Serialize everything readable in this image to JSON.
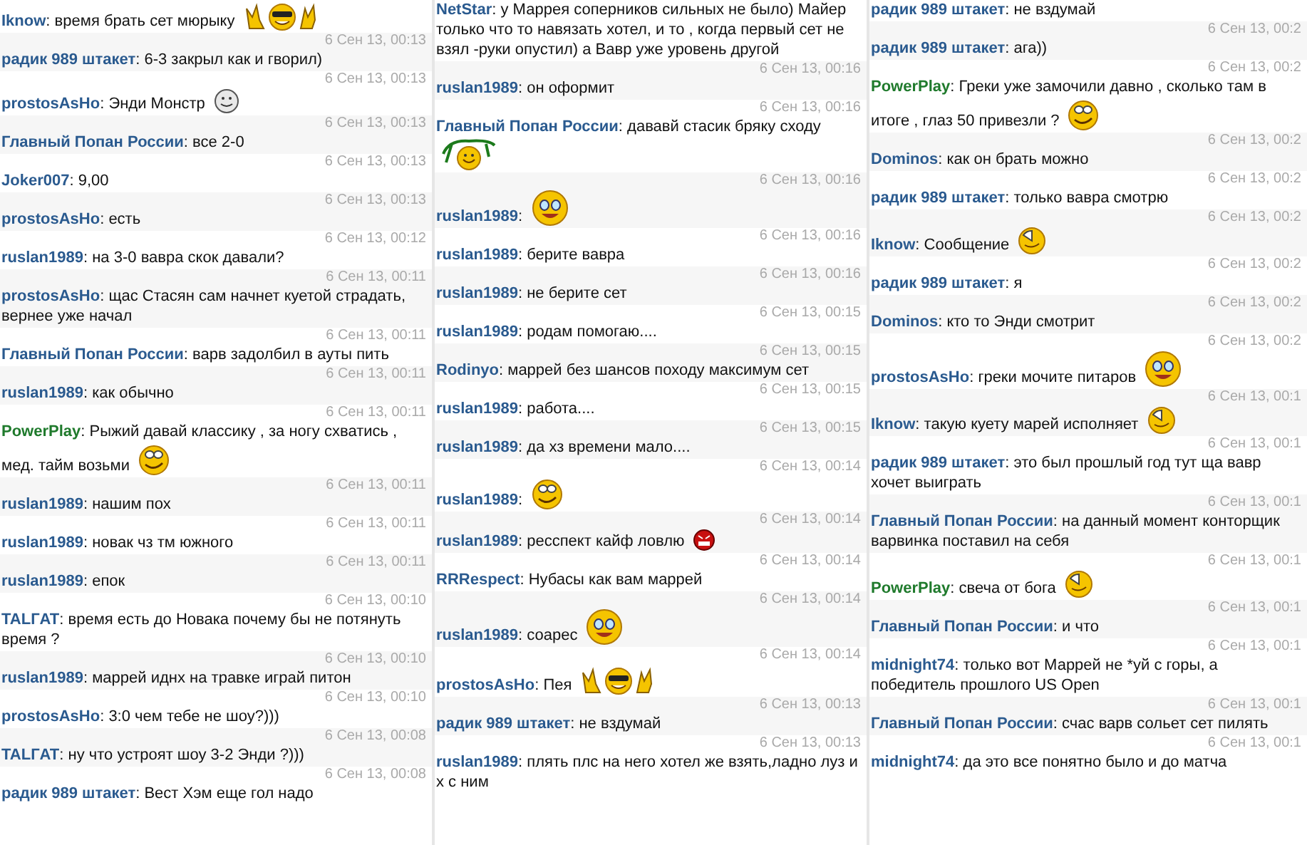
{
  "columns": [
    {
      "messages": [
        {
          "author": "Iknow",
          "separator": ":",
          "color": "#2a5a8f",
          "text": "время брать сет мюрыку",
          "emoticon": {
            "kind": "victory"
          }
        },
        {
          "time": "6 Сен 13, 00:13",
          "author": "радик 989 штакет",
          "separator": ":",
          "color": "#2a5a8f",
          "text": "6-3 закрыл как и гворил)"
        },
        {
          "time": "6 Сен 13, 00:13",
          "author": "prostosAsHo",
          "separator": ":",
          "color": "#2a5a8f",
          "text": "Энди Монстр",
          "emoticon": {
            "kind": "smile"
          }
        },
        {
          "time": "6 Сен 13, 00:13",
          "author": "Главный Попан России",
          "separator": ":",
          "color": "#2a5a8f",
          "text": "все 2-0"
        },
        {
          "time": "6 Сен 13, 00:13",
          "author": "Joker007",
          "separator": ":",
          "color": "#2a5a8f",
          "text": "9,00"
        },
        {
          "time": "6 Сен 13, 00:13",
          "author": "prostosAsHo",
          "separator": ":",
          "color": "#2a5a8f",
          "text": "есть"
        },
        {
          "time": "6 Сен 13, 00:12",
          "author": "ruslan1989",
          "separator": ":",
          "color": "#2a5a8f",
          "text": "на 3-0 вавра скок давали?"
        },
        {
          "time": "6 Сен 13, 00:11",
          "author": "prostosAsHo",
          "separator": ":",
          "color": "#2a5a8f",
          "text": "щас Стасян сам начнет куетой страдать, вернее уже начал"
        },
        {
          "time": "6 Сен 13, 00:11",
          "author": "Главный Попан России",
          "separator": ":",
          "color": "#2a5a8f",
          "text": "варв задолбил в ауты пить"
        },
        {
          "time": "6 Сен 13, 00:11",
          "author": "ruslan1989",
          "separator": ":",
          "color": "#2a5a8f",
          "text": "как обычно"
        },
        {
          "time": "6 Сен 13, 00:11",
          "author": "PowerPlay",
          "separator": ":",
          "color": "#1f7a2c",
          "text": "Рыжий давай классику , за ногу схватись , мед. тайм возьми",
          "emoticon": {
            "kind": "wink"
          }
        },
        {
          "time": "6 Сен 13, 00:11",
          "author": "ruslan1989",
          "separator": ":",
          "color": "#2a5a8f",
          "text": "нашим пох"
        },
        {
          "time": "6 Сен 13, 00:11",
          "author": "ruslan1989",
          "separator": ":",
          "color": "#2a5a8f",
          "text": "новак чз тм южного"
        },
        {
          "time": "6 Сен 13, 00:11",
          "author": "ruslan1989",
          "separator": ":",
          "color": "#2a5a8f",
          "text": "епок"
        },
        {
          "time": "6 Сен 13, 00:10",
          "author": "TALГAT",
          "separator": ":",
          "color": "#2a5a8f",
          "text": "время есть до Новака почему бы не потянуть время ?"
        },
        {
          "time": "6 Сен 13, 00:10",
          "author": "ruslan1989",
          "separator": ":",
          "color": "#2a5a8f",
          "text": "маррей иднх на травке играй питон"
        },
        {
          "time": "6 Сен 13, 00:10",
          "author": "prostosAsHo",
          "separator": ":",
          "color": "#2a5a8f",
          "text": "3:0 чем тебе не шоу?)))"
        },
        {
          "time": "6 Сен 13, 00:08",
          "author": "TALГAT",
          "separator": ":",
          "color": "#2a5a8f",
          "text": "ну что устроят шоу 3-2 Энди ?)))"
        },
        {
          "time": "6 Сен 13, 00:08",
          "author": "радик 989 штакет",
          "separator": ":",
          "color": "#2a5a8f",
          "text": "Вест Хэм еще гол надо"
        }
      ]
    },
    {
      "messages": [
        {
          "author": "NetStar",
          "separator": ":",
          "color": "#2a5a8f",
          "text": "у Маррея соперников сильных не было) Майер только что то навязать хотел, и то , когда первый сет не взял -руки опустил) а Вавр уже уровень другой"
        },
        {
          "time": "6 Сен 13, 00:16",
          "author": "ruslan1989",
          "separator": ":",
          "color": "#2a5a8f",
          "text": "он оформит"
        },
        {
          "time": "6 Сен 13, 00:16",
          "author": "Главный Попан России",
          "separator": ":",
          "color": "#2a5a8f",
          "text": "дававй стасик бряку сходу",
          "emoticon": {
            "kind": "swing"
          }
        },
        {
          "time": "6 Сен 13, 00:16",
          "author": "ruslan1989",
          "separator": ":",
          "color": "#2a5a8f",
          "emoticon": {
            "kind": "laugh"
          }
        },
        {
          "time": "6 Сен 13, 00:16",
          "author": "ruslan1989",
          "separator": ":",
          "color": "#2a5a8f",
          "text": "берите вавра"
        },
        {
          "time": "6 Сен 13, 00:16",
          "author": "ruslan1989",
          "separator": ":",
          "color": "#2a5a8f",
          "text": "не берите сет"
        },
        {
          "time": "6 Сен 13, 00:15",
          "author": "ruslan1989",
          "separator": ":",
          "color": "#2a5a8f",
          "text": "родам помогаю...."
        },
        {
          "time": "6 Сен 13, 00:15",
          "author": "Rodinyo",
          "separator": ":",
          "color": "#2a5a8f",
          "text": "маррей без шансов походу максимум сет"
        },
        {
          "time": "6 Сен 13, 00:15",
          "author": "ruslan1989",
          "separator": ":",
          "color": "#2a5a8f",
          "text": "работа...."
        },
        {
          "time": "6 Сен 13, 00:15",
          "author": "ruslan1989",
          "separator": ":",
          "color": "#2a5a8f",
          "text": "да хз времени мало...."
        },
        {
          "time": "6 Сен 13, 00:14",
          "author": "ruslan1989",
          "separator": ":",
          "color": "#2a5a8f",
          "emoticon": {
            "kind": "wink"
          }
        },
        {
          "time": "6 Сен 13, 00:14",
          "author": "ruslan1989",
          "separator": ":",
          "color": "#2a5a8f",
          "text": "ресспект кайф ловлю",
          "emoticon": {
            "kind": "angry"
          }
        },
        {
          "time": "6 Сен 13, 00:14",
          "author": "RRRespect",
          "separator": ":",
          "color": "#2a5a8f",
          "text": "Нубасы как вам маррей"
        },
        {
          "time": "6 Сен 13, 00:14",
          "author": "ruslan1989",
          "separator": ":",
          "color": "#2a5a8f",
          "text": "соарес",
          "emoticon": {
            "kind": "laugh"
          }
        },
        {
          "time": "6 Сен 13, 00:14",
          "author": "prostosAsHo",
          "separator": ":",
          "color": "#2a5a8f",
          "text": "Пея",
          "emoticon": {
            "kind": "victory"
          }
        },
        {
          "time": "6 Сен 13, 00:13",
          "author": "радик 989 штакет",
          "separator": ":",
          "color": "#2a5a8f",
          "text": "не вздумай"
        },
        {
          "time": "6 Сен 13, 00:13",
          "author": "ruslan1989",
          "separator": ":",
          "color": "#2a5a8f",
          "text": "плять плс на него хотел же взять,ладно луз и х с ним"
        }
      ]
    },
    {
      "messages": [
        {
          "author": "радик 989 штакет",
          "separator": ":",
          "color": "#2a5a8f",
          "text": "не вздумай"
        },
        {
          "time": "6 Сен 13, 00:2",
          "author": "радик 989 штакет",
          "separator": ":",
          "color": "#2a5a8f",
          "text": "ага))"
        },
        {
          "time": "6 Сен 13, 00:2",
          "author": "PowerPlay",
          "separator": ":",
          "color": "#1f7a2c",
          "text": "Греки уже замочили давно , сколько там в итоге , глаз 50 привезли ?",
          "emoticon": {
            "kind": "wink"
          }
        },
        {
          "time": "6 Сен 13, 00:2",
          "author": "Dominos",
          "separator": ":",
          "color": "#2a5a8f",
          "text": "как он брать можно"
        },
        {
          "time": "6 Сен 13, 00:2",
          "author": "радик 989 штакет",
          "separator": ":",
          "color": "#2a5a8f",
          "text": "только вавра смотрю"
        },
        {
          "time": "6 Сен 13, 00:2",
          "author": "Iknow",
          "separator": ":",
          "color": "#2a5a8f",
          "text": "Сообщение",
          "emoticon": {
            "kind": "clock"
          }
        },
        {
          "time": "6 Сен 13, 00:2",
          "author": "радик 989 штакет",
          "separator": ":",
          "color": "#2a5a8f",
          "text": "я"
        },
        {
          "time": "6 Сен 13, 00:2",
          "author": "Dominos",
          "separator": ":",
          "color": "#2a5a8f",
          "text": "кто то Энди смотрит"
        },
        {
          "time": "6 Сен 13, 00:2",
          "author": "prostosAsHo",
          "separator": ":",
          "color": "#2a5a8f",
          "text": "греки мочите питаров",
          "emoticon": {
            "kind": "laugh"
          }
        },
        {
          "time": "6 Сен 13, 00:1",
          "author": "Iknow",
          "separator": ":",
          "color": "#2a5a8f",
          "text": "такую куету марей исполняет",
          "emoticon": {
            "kind": "clock"
          }
        },
        {
          "time": "6 Сен 13, 00:1",
          "author": "радик 989 штакет",
          "separator": ":",
          "color": "#2a5a8f",
          "text": "это был прошлый год тут ща вавр хочет выиграть"
        },
        {
          "time": "6 Сен 13, 00:1",
          "author": "Главный Попан России",
          "separator": ":",
          "color": "#2a5a8f",
          "text": "на данный момент конторщик варвинка поставил на себя"
        },
        {
          "time": "6 Сен 13, 00:1",
          "author": "PowerPlay",
          "separator": ":",
          "color": "#1f7a2c",
          "text": "свеча от бога",
          "emoticon": {
            "kind": "clock"
          }
        },
        {
          "time": "6 Сен 13, 00:1",
          "author": "Главный Попан России",
          "separator": ":",
          "color": "#2a5a8f",
          "text": "и что"
        },
        {
          "time": "6 Сен 13, 00:1",
          "author": "midnight74",
          "separator": ":",
          "color": "#2a5a8f",
          "text": "только вот Маррей не *уй с горы, а победитель прошлого US Open"
        },
        {
          "time": "6 Сен 13, 00:1",
          "author": "Главный Попан России",
          "separator": ":",
          "color": "#2a5a8f",
          "text": "счас варв сольет сет пилять"
        },
        {
          "time": "6 Сен 13, 00:1",
          "author": "midnight74",
          "separator": ":",
          "color": "#2a5a8f",
          "text": "да это все понятно было и до матча"
        }
      ]
    }
  ]
}
